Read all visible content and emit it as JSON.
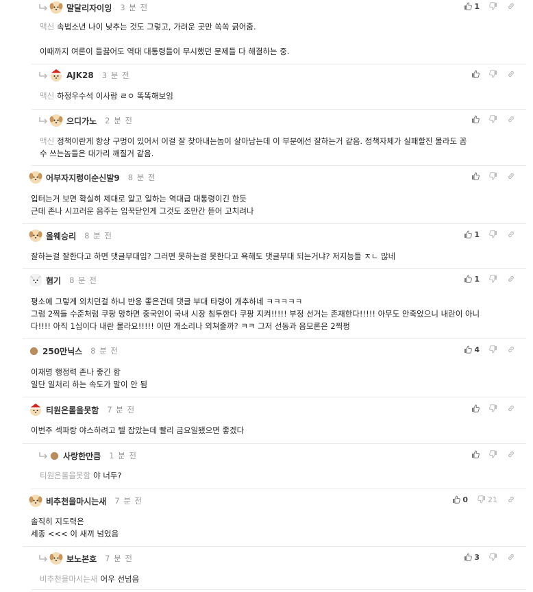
{
  "comments": [
    {
      "kind": "reply",
      "nick": "말달리자이잉",
      "time": "3 분 전",
      "mention": "맥신",
      "lines": [
        "속법소년 나이 낮추는 것도 그렇고, 가려운 곳만 쏙쏙 긁어줌.",
        "",
        "이때까지 여론이 들끓어도 역대 대통령들이 무시했던 문제들 다 해결하는 중."
      ],
      "up": "1",
      "down": "",
      "avatar": "dog"
    },
    {
      "kind": "reply",
      "nick": "AJK28",
      "time": "3 분 전",
      "mention": "맥신",
      "lines": [
        "하정우수석 이사람 ㄹㅇ 똑똑해보임"
      ],
      "up": "",
      "down": "",
      "avatar": "red"
    },
    {
      "kind": "reply",
      "nick": "으디가노",
      "time": "2 분 전",
      "mention": "맥신",
      "lines": [
        "정책이란게 항상 구멍이 있어서 이걸 잘 찾아내는놈이 살아남는데 이 부분에선 잘하는거 같음. 정책자체가 실패할진 몰라도 꼼",
        "수 쓰는놈들은 대가리 깨질거 같음."
      ],
      "up": "",
      "down": "",
      "avatar": "dog"
    },
    {
      "kind": "top",
      "nick": "어부자지렁이순신발9",
      "time": "8 분 전",
      "mention": "",
      "lines": [
        "입터는거 보면 확실히 제대로 알고 일하는 역대급 대통령이긴 한듯",
        "근데 존나 시끄러운 음주는 입꾹닫인게 그것도 조만간 뜯어 고치려나"
      ],
      "up": "",
      "down": "",
      "avatar": "dog"
    },
    {
      "kind": "top",
      "nick": "올웨승리",
      "time": "8 분 전",
      "mention": "",
      "lines": [
        "잘하는걸 잘한다고 하면 댓글부대임? 그러면 못하는걸 못한다고 욕해도 댓글부대 되는거냐? 저지능들 ㅈㄴ 많네"
      ],
      "up": "1",
      "down": "",
      "avatar": "dog"
    },
    {
      "kind": "top",
      "nick": "혐기",
      "time": "8 분 전",
      "mention": "",
      "lines": [
        "평소에 그렇게 외치던걸 하니 반응 좋은건데 댓글 부대 타령이 개추하네 ㅋㅋㅋㅋㅋ",
        "그럼 2찍들 수준처럼 쿠팡 망하면 중국인이 국내 시장 침투한다 쿠팡 지켜!!!!! 부정 선거는 존재한다!!!!! 아무도 안죽었으니 내란이 아니",
        "다!!!! 아직 1심이다 내란 몰라요!!!!! 이딴 개소리나 외쳐줄까? ㅋㅋ 그저 선동과 음모론은 2찍펑"
      ],
      "up": "1",
      "down": "",
      "avatar": "white"
    },
    {
      "kind": "top",
      "nick": "250만닉스",
      "time": "8 분 전",
      "mention": "",
      "lines": [
        "이재명 행정력 존나 좋긴 함",
        "일단 일처리 하는 속도가 말이 안 됨"
      ],
      "up": "4",
      "down": "",
      "avatar": "brown"
    },
    {
      "kind": "top",
      "nick": "티원은롤을못함",
      "time": "7 분 전",
      "mention": "",
      "lines": [
        "이번주 섹파랑 야스하려고 텔 잡았는데 빨리 금요일됐으면 좋겠다"
      ],
      "up": "",
      "down": "",
      "avatar": "red"
    },
    {
      "kind": "reply",
      "nick": "사랑한만큼",
      "time": "1 분 전",
      "mention": "티원은롤을못함",
      "lines": [
        "야 너두?"
      ],
      "up": "",
      "down": "",
      "avatar": "brown"
    },
    {
      "kind": "top",
      "nick": "비추천을마시는새",
      "time": "7 분 전",
      "mention": "",
      "lines": [
        "솔직히 지도력은",
        "세종 <<< 이 새끼 넘었음"
      ],
      "up": "0",
      "down": "21",
      "avatar": "dog"
    },
    {
      "kind": "reply",
      "nick": "보노본호",
      "time": "7 분 전",
      "mention": "비추천을마시는새",
      "lines": [
        "어우 선넘음"
      ],
      "up": "3",
      "down": "",
      "avatar": "dog"
    }
  ],
  "colors": {
    "text": "#222222",
    "muted": "#999999",
    "mention": "#aaaaaa",
    "divider": "#e9e9e9"
  },
  "icons": {
    "up": "thumbs-up-icon",
    "down": "thumbs-down-icon",
    "share": "link-icon",
    "reply": "reply-arrow-icon"
  }
}
